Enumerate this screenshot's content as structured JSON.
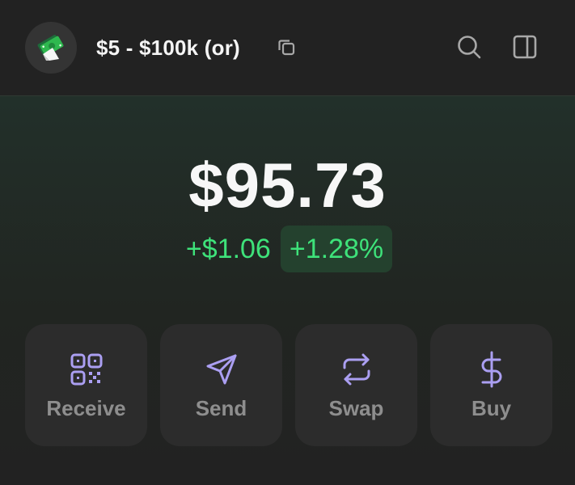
{
  "header": {
    "account_name": "$5 - $100k (or)",
    "avatar_icon": "money-bills-icon",
    "copy_icon": "copy-icon",
    "search_icon": "search-icon",
    "panel_icon": "side-panel-icon"
  },
  "balance": {
    "amount": "$95.73",
    "change_abs": "+$1.06",
    "change_pct": "+1.28%"
  },
  "actions": [
    {
      "label": "Receive",
      "icon": "qr-code-icon"
    },
    {
      "label": "Send",
      "icon": "send-icon"
    },
    {
      "label": "Swap",
      "icon": "swap-icon"
    },
    {
      "label": "Buy",
      "icon": "dollar-icon"
    }
  ],
  "colors": {
    "background": "#222222",
    "positive": "#3ee27a",
    "positive_bg": "#24412e",
    "accent_icon": "#ab9ff2",
    "button_bg": "#2c2c2c",
    "button_label": "#8e8e8e"
  }
}
